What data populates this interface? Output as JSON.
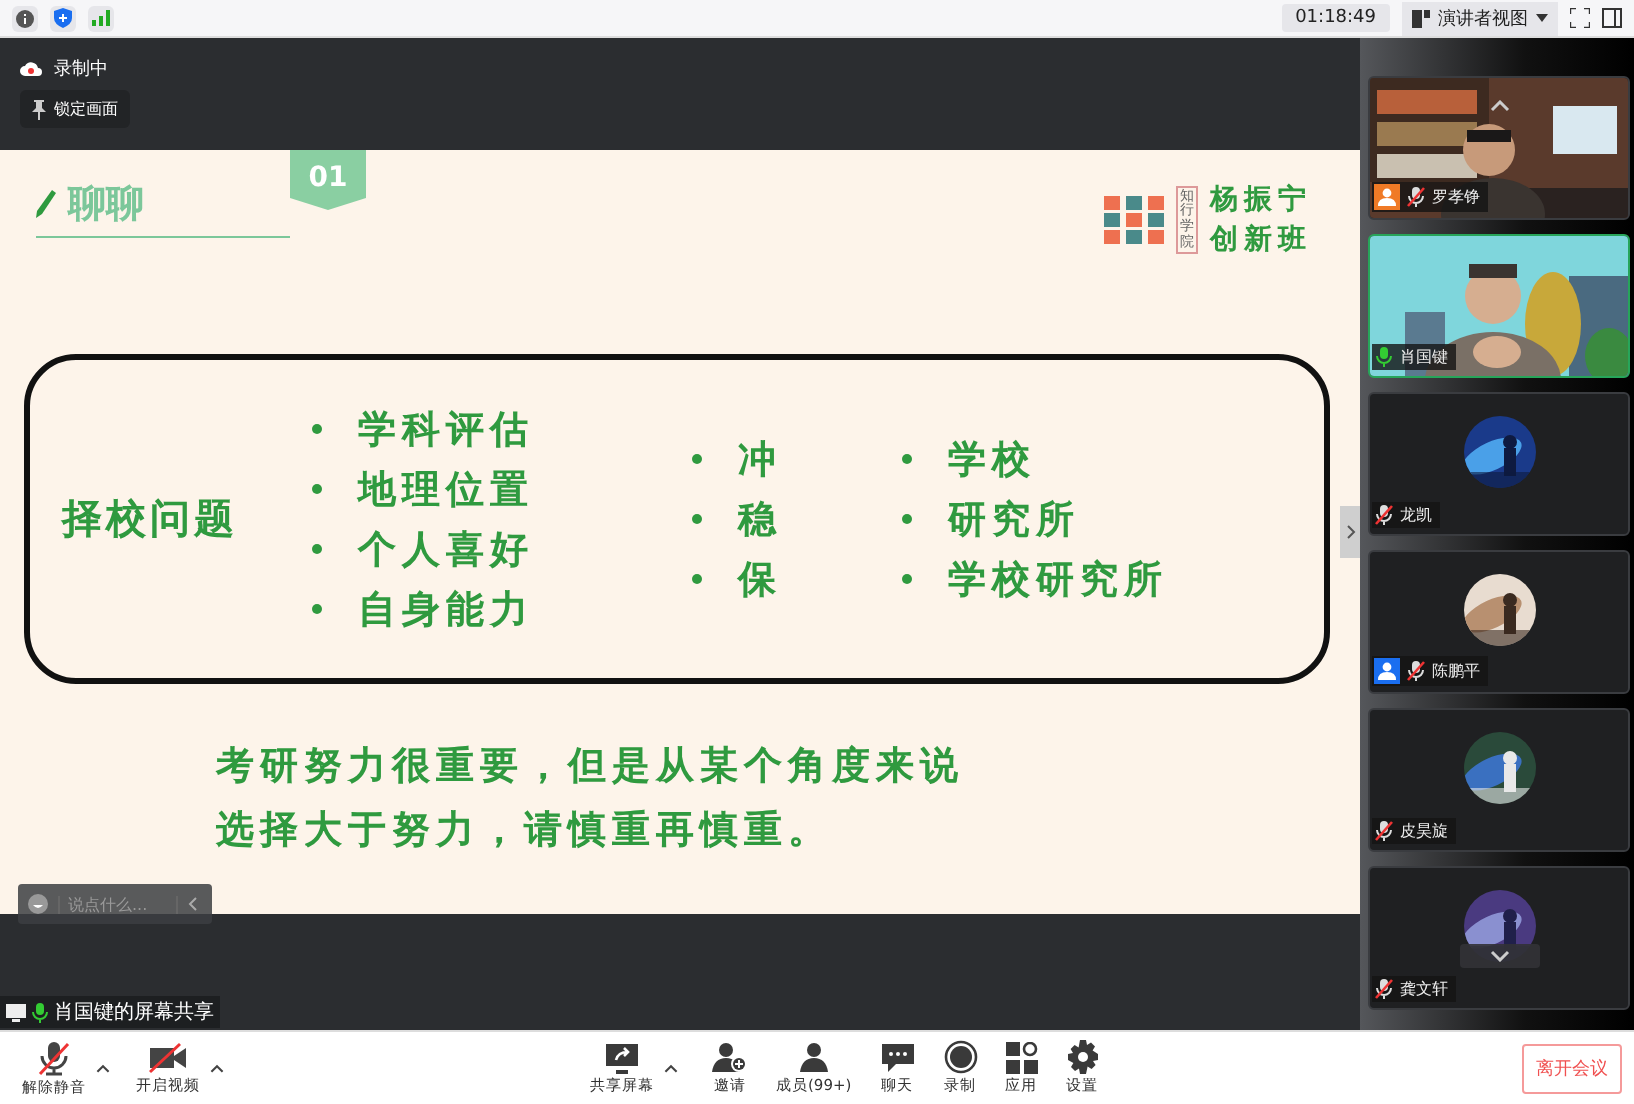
{
  "top_bar": {
    "timer": "01:18:49",
    "view_menu": {
      "label": "演讲者视图"
    }
  },
  "recording": {
    "label": "录制中"
  },
  "pin_button": {
    "label": "锁定画面"
  },
  "slide": {
    "title": "聊聊",
    "number": "01",
    "logo": {
      "school": "知行学院",
      "name_lines": [
        "杨振宁",
        "创新班"
      ]
    },
    "topic": "择校问题",
    "columns": [
      [
        "学科评估",
        "地理位置",
        "个人喜好",
        "自身能力"
      ],
      [
        "冲",
        "稳",
        "保"
      ],
      [
        "学校",
        "研究所",
        "学校研究所"
      ]
    ],
    "conclusion": [
      "考研努力很重要，但是从某个角度来说",
      "选择大于努力，请慎重再慎重。"
    ]
  },
  "chat_input": {
    "placeholder": "说点什么..."
  },
  "share_label": "肖国键的屏幕共享",
  "participants": [
    {
      "name": "罗孝铮",
      "kind": "video",
      "muted": true,
      "selected": false,
      "badge": {
        "color": "#f07a26"
      }
    },
    {
      "name": "肖国键",
      "kind": "video",
      "muted": false,
      "selected": true
    },
    {
      "name": "龙凯",
      "kind": "avatar",
      "muted": true,
      "selected": false
    },
    {
      "name": "陈鹏平",
      "kind": "avatar",
      "muted": true,
      "selected": false,
      "badge": {
        "color": "#1a6ef0"
      }
    },
    {
      "name": "皮昊旋",
      "kind": "avatar",
      "muted": true,
      "selected": false
    },
    {
      "name": "龚文轩",
      "kind": "avatar",
      "muted": true,
      "selected": false
    }
  ],
  "toolbar": {
    "left": [
      {
        "label": "解除静音",
        "kind": "mic-off"
      },
      {
        "label": "开启视频",
        "kind": "camera-off"
      }
    ],
    "center": [
      {
        "label": "共享屏幕",
        "kind": "share"
      },
      {
        "label": "邀请",
        "kind": "invite"
      },
      {
        "label": "成员(99+)",
        "kind": "members"
      },
      {
        "label": "聊天",
        "kind": "chat"
      },
      {
        "label": "录制",
        "kind": "record"
      },
      {
        "label": "应用",
        "kind": "apps"
      },
      {
        "label": "设置",
        "kind": "settings"
      }
    ],
    "leave_button": {
      "label": "离开会议"
    }
  }
}
